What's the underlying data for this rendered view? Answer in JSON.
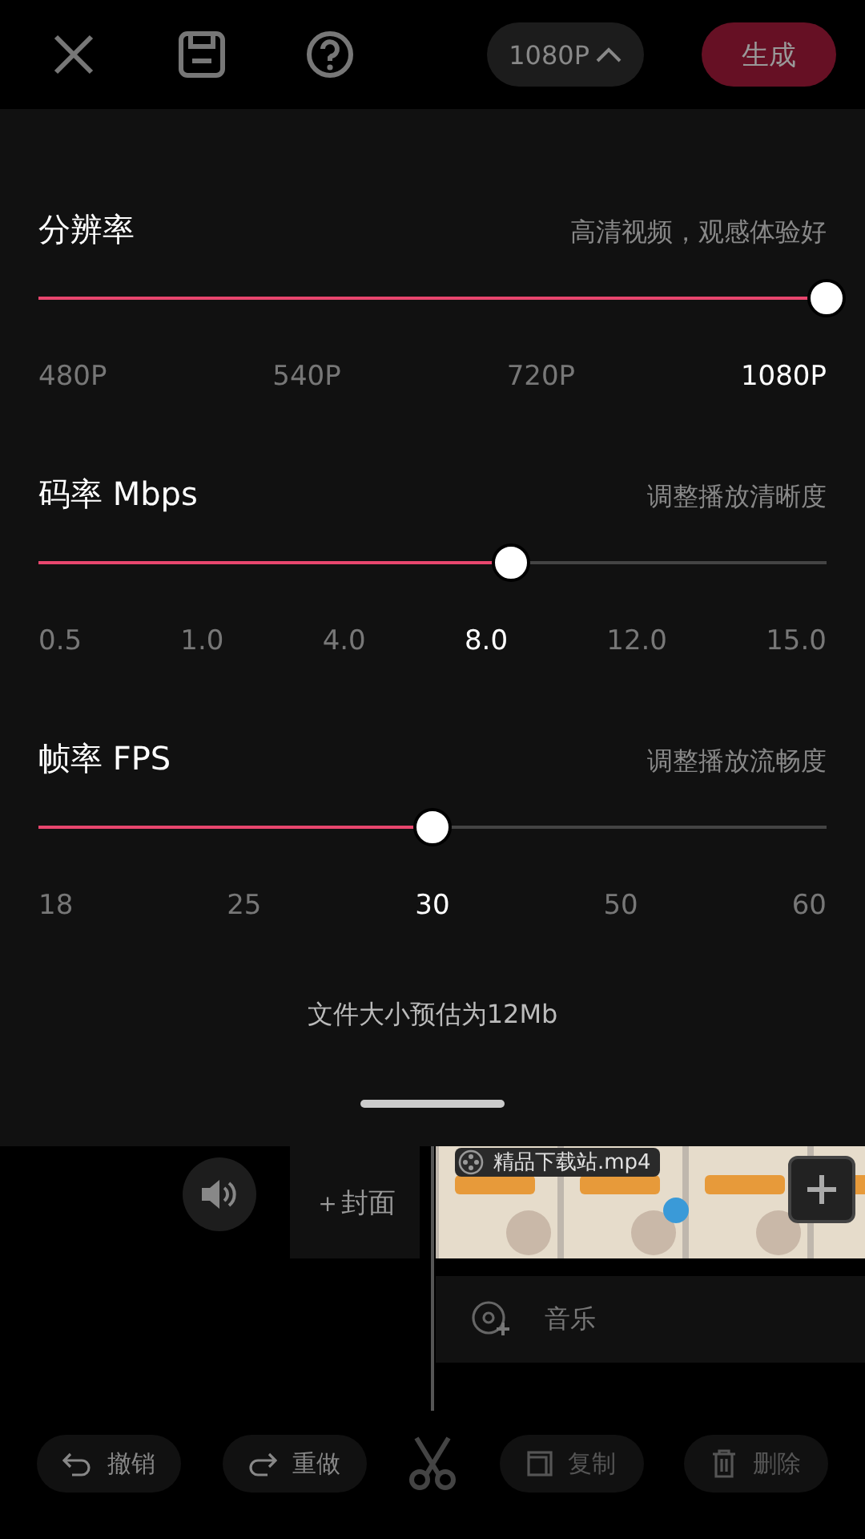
{
  "top_bar": {
    "resolution_menu": "1080P",
    "generate_button": "生成"
  },
  "sliders": [
    {
      "title": "分辨率",
      "hint": "高清视频，观感体验好",
      "level": 1,
      "ticks": [
        {
          "label": "480P",
          "selected": false
        },
        {
          "label": "540P",
          "selected": false
        },
        {
          "label": "720P",
          "selected": false
        },
        {
          "label": "1080P",
          "selected": true
        }
      ]
    },
    {
      "title": "码率 Mbps",
      "hint": "调整播放清晰度",
      "level": 0.6,
      "ticks": [
        {
          "label": "0.5",
          "selected": false
        },
        {
          "label": "1.0",
          "selected": false
        },
        {
          "label": "4.0",
          "selected": false
        },
        {
          "label": "8.0",
          "selected": true
        },
        {
          "label": "12.0",
          "selected": false
        },
        {
          "label": "15.0",
          "selected": false
        }
      ]
    },
    {
      "title": "帧率 FPS",
      "hint": "调整播放流畅度",
      "level": 0.5,
      "ticks": [
        {
          "label": "18",
          "selected": false
        },
        {
          "label": "25",
          "selected": false
        },
        {
          "label": "30",
          "selected": true
        },
        {
          "label": "50",
          "selected": false
        },
        {
          "label": "60",
          "selected": false
        }
      ]
    }
  ],
  "file_size_note": "文件大小预估为12Mb",
  "timeline": {
    "cover_button": "＋封面",
    "clip": {
      "name": "精品下载站.mp4",
      "kind": "picture"
    },
    "music_track": "音乐"
  },
  "toolbar": [
    {
      "label": "撤销",
      "kind": "undo",
      "disabled": false
    },
    {
      "label": "重做",
      "kind": "redo",
      "disabled": false
    },
    {
      "kind": "cut",
      "disabled": false
    },
    {
      "label": "复制",
      "kind": "copy",
      "disabled": true
    },
    {
      "label": "删除",
      "kind": "delete",
      "disabled": true
    }
  ]
}
